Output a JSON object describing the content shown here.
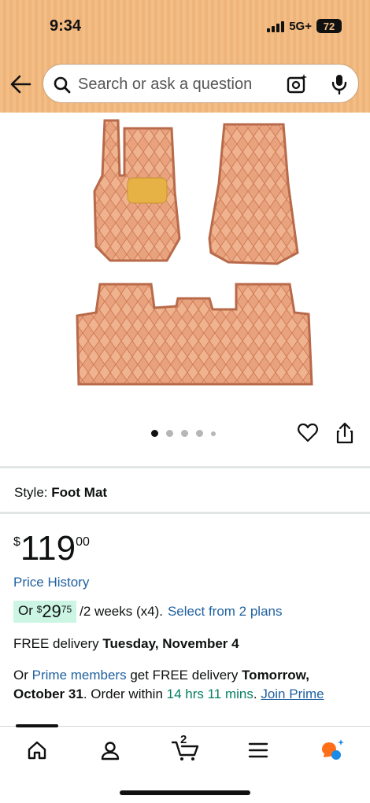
{
  "status_bar": {
    "time": "9:34",
    "network": "5G+",
    "battery": "72"
  },
  "search": {
    "placeholder": "Search or ask a question"
  },
  "icons": {
    "back": "arrow-left-icon",
    "search": "search-icon",
    "camera": "camera-scan-icon",
    "mic": "microphone-icon",
    "favorite": "heart-icon",
    "share": "share-icon",
    "home": "home-icon",
    "account": "person-icon",
    "cart": "cart-icon",
    "menu": "menu-icon",
    "rufus": "chat-sparkle-icon"
  },
  "gallery": {
    "image_count": 5,
    "active_index": 0
  },
  "product": {
    "style_label": "Style:",
    "style_value": "Foot Mat",
    "price_symbol": "$",
    "price_whole": "119",
    "price_fraction": "00",
    "price_history": "Price History",
    "installment_prefix": "Or",
    "installment_symbol": "$",
    "installment_whole": "29",
    "installment_fraction": "75",
    "installment_terms": "/2 weeks (x4).",
    "installment_link": "Select from 2 plans"
  },
  "delivery": {
    "free_prefix": "FREE delivery",
    "free_date": "Tuesday, November 4",
    "prime_or": "Or",
    "prime_link": "Prime members",
    "prime_mid": "get FREE delivery",
    "prime_date": "Tomorrow, October 31",
    "order_within_prefix": ". Order within",
    "countdown": "14 hrs 11 mins",
    "join_prime": "Join Prime"
  },
  "tabbar": {
    "cart_count": "2",
    "active_tab": "home"
  },
  "colors": {
    "header_bg": "#f3bd86",
    "link": "#2162a1",
    "deal_green": "#067d62",
    "installment_bg": "#ccf5e4"
  }
}
